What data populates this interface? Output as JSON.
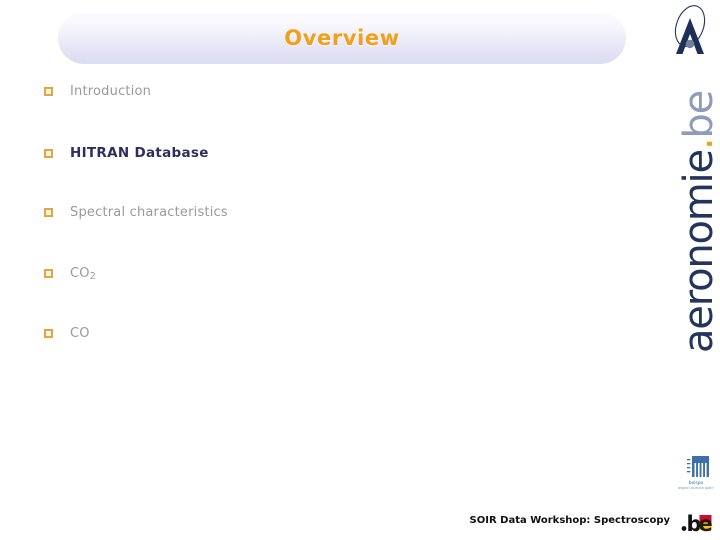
{
  "slide": {
    "title": "Overview",
    "title_color": "#f0a11b",
    "background_color": "#ffffff"
  },
  "bullets": [
    {
      "label": "Introduction",
      "marker": "hollow-square-bullet",
      "emphasis": false
    },
    {
      "label": "HITRAN Database",
      "marker": "hollow-square-bullet",
      "emphasis": true
    },
    {
      "label": "Spectral characteristics",
      "marker": "hollow-square-bullet",
      "emphasis": false
    },
    {
      "label": "CO",
      "sub": "2",
      "marker": "hollow-square-bullet",
      "emphasis": false
    },
    {
      "label": "CO",
      "marker": "hollow-square-bullet",
      "emphasis": false
    }
  ],
  "brand": {
    "logo_name": "aeronomie-a-orbit-logo",
    "name_main": "aeronomie",
    "name_dot": ".",
    "name_tld": "be",
    "color_main": "#23355c",
    "color_dot": "#f0a11b",
    "color_tld": "#8e9cba"
  },
  "footer": {
    "text": "SOIR Data Workshop: Spectroscopy",
    "belspo_logo_name": "belspo-belgian-science-policy-logo",
    "belspo_caption_line1": "belspo",
    "belspo_caption_line2": "belgian science policy",
    "be_logo_name": "dot-be-logo",
    "be_logo_dot": ".",
    "be_logo_b": "b",
    "be_logo_e": "e"
  }
}
